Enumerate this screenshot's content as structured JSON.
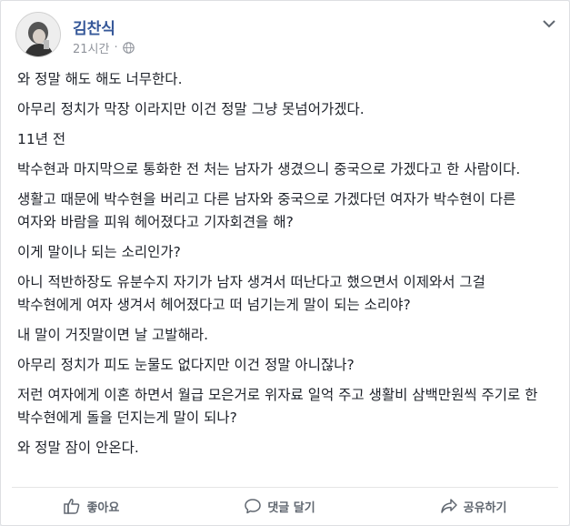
{
  "post": {
    "author": "김찬식",
    "time": "21시간",
    "separator": "·",
    "privacy_icon": "globe-icon",
    "options_icon": "chevron-down-icon",
    "paragraphs": [
      "와 정말 해도 해도 너무한다.",
      "아무리 정치가 막장 이라지만 이건 정말 그냥 못넘어가겠다.",
      "11년 전",
      "박수현과 마지막으로 통화한 전 처는 남자가 생겼으니 중국으로 가겠다고 한 사람이다.",
      "생활고 때문에 박수현을 버리고 다른 남자와 중국으로 가겠다던 여자가 박수현이 다른 여자와 바람을 피워 헤어졌다고 기자회견을 해?",
      "이게 말이나 되는 소리인가?",
      "아니 적반하장도 유분수지 자기가 남자 생겨서 떠난다고 했으면서 이제와서 그걸 박수현에게 여자 생겨서 헤어졌다고 떠 넘기는게 말이 되는 소리야?",
      "내 말이 거짓말이면 날 고발해라.",
      "아무리 정치가 피도 눈물도 없다지만 이건 정말 아니잖나?",
      "저런 여자에게 이혼 하면서 월급 모은거로 위자료 일억 주고 생활비 삼백만원씩 주기로 한 박수현에게 돌을 던지는게 말이 되나?",
      "와 정말 잠이 안온다."
    ]
  },
  "actions": {
    "like_label": "좋아요",
    "like_icon": "thumbs-up-icon",
    "comment_label": "댓글 달기",
    "comment_icon": "comment-bubble-icon",
    "share_label": "공유하기",
    "share_icon": "share-arrow-icon"
  },
  "colors": {
    "author_link": "#365899",
    "meta_text": "#90949c",
    "body_text": "#1d2129",
    "action_text": "#606770"
  }
}
